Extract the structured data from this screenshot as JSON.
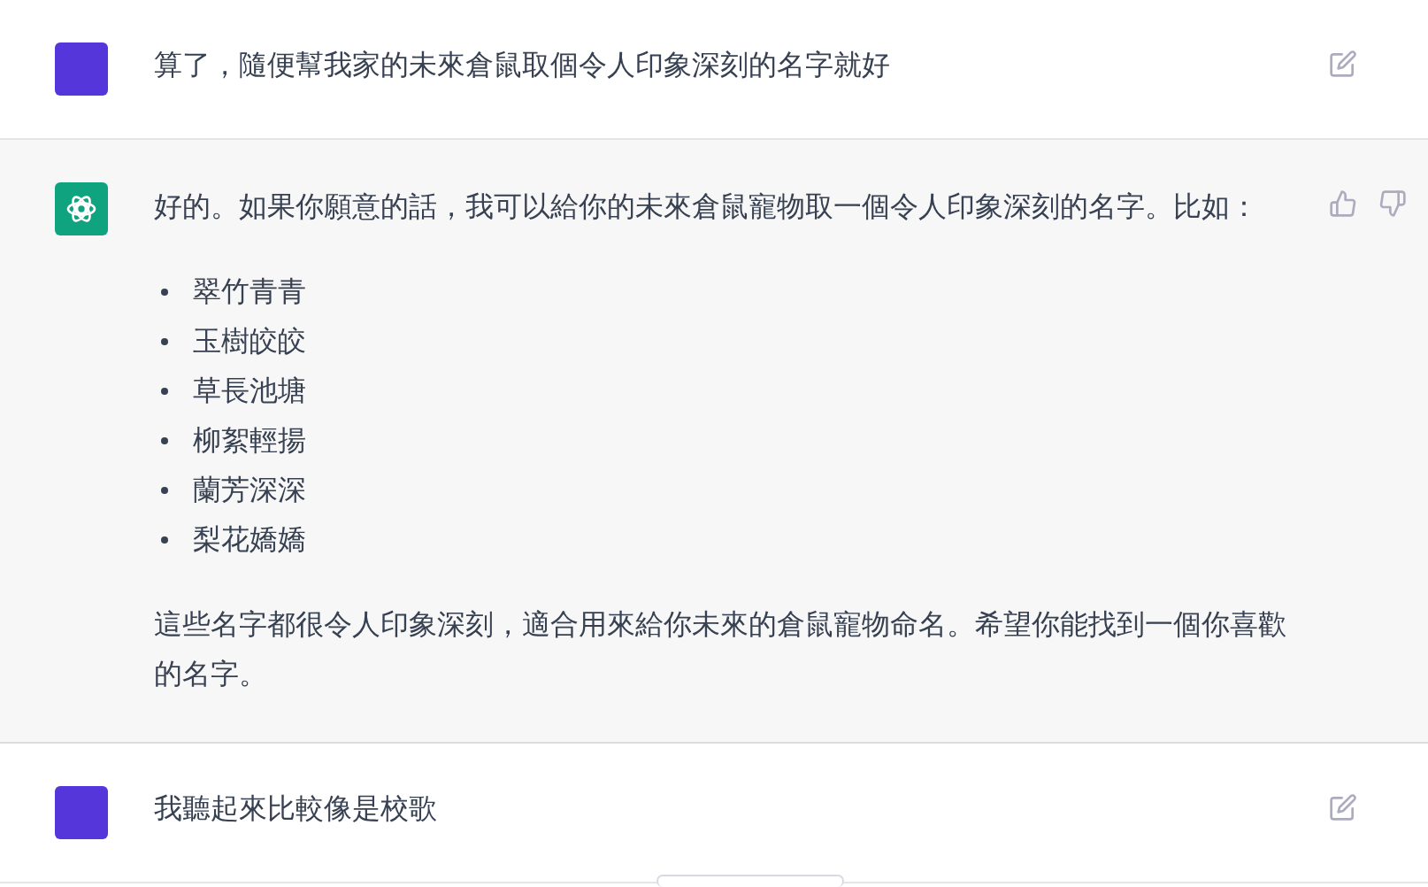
{
  "messages": [
    {
      "kind": "user",
      "text": "算了，隨便幫我家的未來倉鼠取個令人印象深刻的名字就好"
    },
    {
      "kind": "assistant",
      "blocks": [
        {
          "kind": "paragraph",
          "text": "好的。如果你願意的話，我可以給你的未來倉鼠寵物取一個令人印象深刻的名字。比如："
        },
        {
          "kind": "list",
          "items": [
            "翠竹青青",
            "玉樹皎皎",
            "草長池塘",
            "柳絮輕揚",
            "蘭芳深深",
            "梨花嬌嬌"
          ]
        },
        {
          "kind": "paragraph",
          "text": "這些名字都很令人印象深刻，適合用來給你未來的倉鼠寵物命名。希望你能找到一個你喜歡的名字。"
        }
      ]
    },
    {
      "kind": "user",
      "text": "我聽起來比較像是校歌"
    }
  ]
}
